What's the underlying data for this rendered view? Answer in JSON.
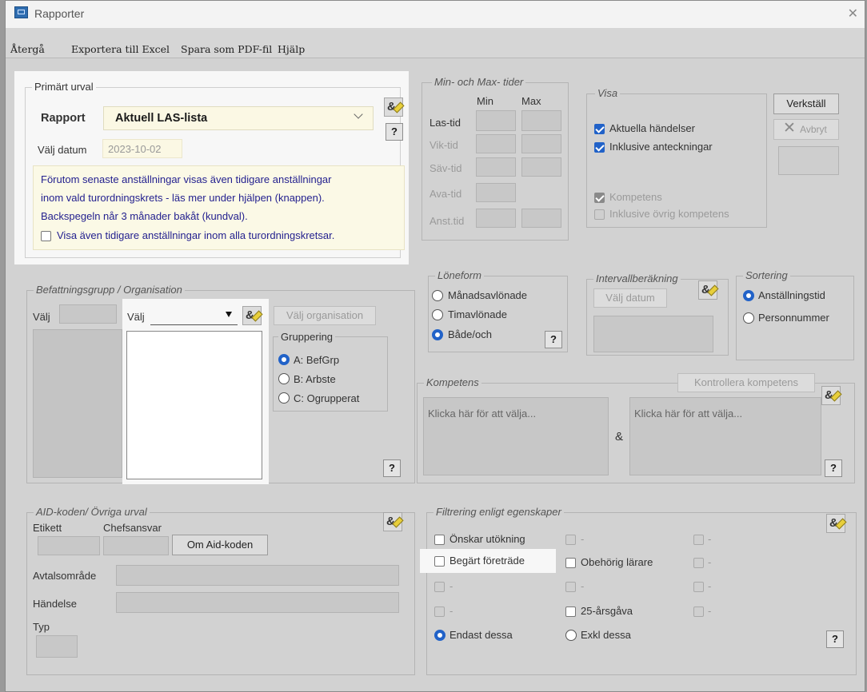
{
  "window": {
    "title": "Rapporter",
    "close": "✕"
  },
  "menu": [
    "Återgå",
    "Exportera till Excel",
    "Spara som PDF-fil",
    "Hjälp"
  ],
  "primary": {
    "title": "Primärt urval",
    "rapport_label": "Rapport",
    "rapport_value": "Aktuell LAS-lista",
    "date_label": "Välj datum",
    "date_value": "2023-10-02",
    "help": "?",
    "info_lines": [
      "Förutom senaste anställningar visas även tidigare anställningar",
      "inom vald turordningskrets - läs mer under hjälpen (knappen).",
      "Backspegeln når 3 månader bakåt (kundval)."
    ],
    "checkbox_label": "Visa även tidigare anställningar inom alla turordningskretsar."
  },
  "minmax": {
    "title": "Min- och Max- tider",
    "min": "Min",
    "max": "Max",
    "rows": [
      "Las-tid",
      "Vik-tid",
      "Säv-tid",
      "Ava-tid",
      "Anst.tid"
    ]
  },
  "visa": {
    "title": "Visa",
    "items": [
      "Aktuella händelser",
      "Inklusive anteckningar",
      "Kompetens",
      "Inklusive övrig kompetens"
    ]
  },
  "actions": {
    "verkstall": "Verkställ",
    "avbryt": "Avbryt"
  },
  "befattning": {
    "title": "Befattningsgrupp / Organisation",
    "valj1": "Välj",
    "valj2": "Välj",
    "valj_org": "Välj organisation",
    "gruppering_title": "Gruppering",
    "gruppering": [
      "A: BefGrp",
      "B: Arbste",
      "C: Ogrupperat"
    ],
    "help": "?"
  },
  "loneform": {
    "title": "Löneform",
    "options": [
      "Månadsavlönade",
      "Timavlönade",
      "Både/och"
    ],
    "help": "?"
  },
  "intervall": {
    "title": "Intervallberäkning",
    "valj_datum": "Välj datum"
  },
  "sortering": {
    "title": "Sortering",
    "options": [
      "Anställningstid",
      "Personnummer"
    ]
  },
  "kompetens": {
    "title": "Kompetens",
    "kontrollera": "Kontrollera kompetens",
    "click1": "Klicka här för att välja...",
    "click2": "Klicka här för att välja...",
    "amp": "&",
    "help": "?"
  },
  "aid": {
    "title": "AID-koden/ Övriga urval",
    "etikett": "Etikett",
    "chefsansvar": "Chefsansvar",
    "om_aid": "Om Aid-koden",
    "avtal": "Avtalsområde",
    "handelse": "Händelse",
    "typ": "Typ"
  },
  "filter": {
    "title": "Filtrering enligt egenskaper",
    "col1": [
      "Önskar utökning",
      "Begärt företräde",
      "-",
      "-"
    ],
    "col2": [
      "-",
      "Obehörig lärare",
      "-",
      "25-årsgåva"
    ],
    "col3": [
      "-",
      "-",
      "-",
      "-"
    ],
    "radio": [
      "Endast dessa",
      "Exkl dessa"
    ],
    "help": "?"
  }
}
